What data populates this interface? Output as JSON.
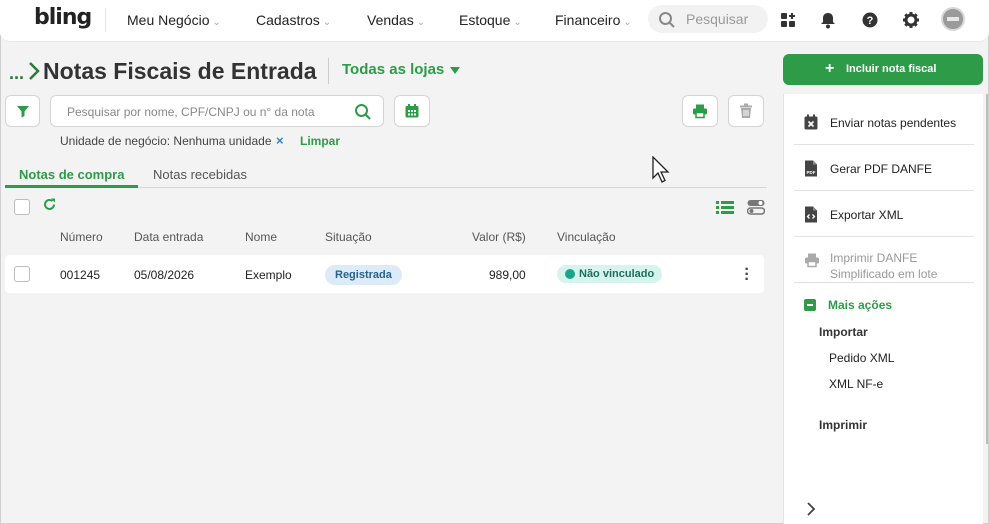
{
  "topbar": {
    "logo": "bling",
    "nav": [
      {
        "label": "Meu Negócio"
      },
      {
        "label": "Cadastros"
      },
      {
        "label": "Vendas"
      },
      {
        "label": "Estoque"
      },
      {
        "label": "Financeiro"
      }
    ],
    "search_placeholder": "Pesquisar",
    "icons": [
      "apps-icon",
      "bell-icon",
      "help-icon",
      "gear-icon",
      "avatar"
    ]
  },
  "page": {
    "breadcrumb_dots": "...",
    "title": "Notas Fiscais de Entrada",
    "store_select": "Todas as lojas"
  },
  "filters": {
    "search_placeholder": "Pesquisar por nome, CPF/CNPJ ou n° da nota",
    "unit_text": "Unidade de negócio: Nenhuma unidade",
    "unit_remove": "×",
    "clear_label": "Limpar"
  },
  "tabs": [
    {
      "label": "Notas de compra",
      "active": true
    },
    {
      "label": "Notas recebidas",
      "active": false
    }
  ],
  "table": {
    "headers": [
      "Número",
      "Data entrada",
      "Nome",
      "Situação",
      "Valor (R$)",
      "Vinculação"
    ],
    "rows": [
      {
        "numero": "001245",
        "data": "05/08/2026",
        "nome": "Exemplo",
        "situacao": "Registrada",
        "valor": "989,00",
        "vinculacao": "Não vinculado"
      }
    ]
  },
  "side": {
    "include_button": "Incluir nota fiscal",
    "items": [
      {
        "label": "Enviar notas pendentes"
      },
      {
        "label": "Gerar PDF DANFE"
      },
      {
        "label": "Exportar XML"
      },
      {
        "label_line1": "Imprimir DANFE",
        "label_line2": "Simplificado em lote"
      }
    ],
    "more_actions": "Mais ações",
    "import_heading": "Importar",
    "import_items": [
      "Pedido XML",
      "XML NF-e"
    ],
    "print_heading": "Imprimir"
  },
  "colors": {
    "accent": "#2e9b48",
    "registrada_bg": "#dcebf7",
    "nao_vinculado_bg": "#d7f3ee"
  }
}
